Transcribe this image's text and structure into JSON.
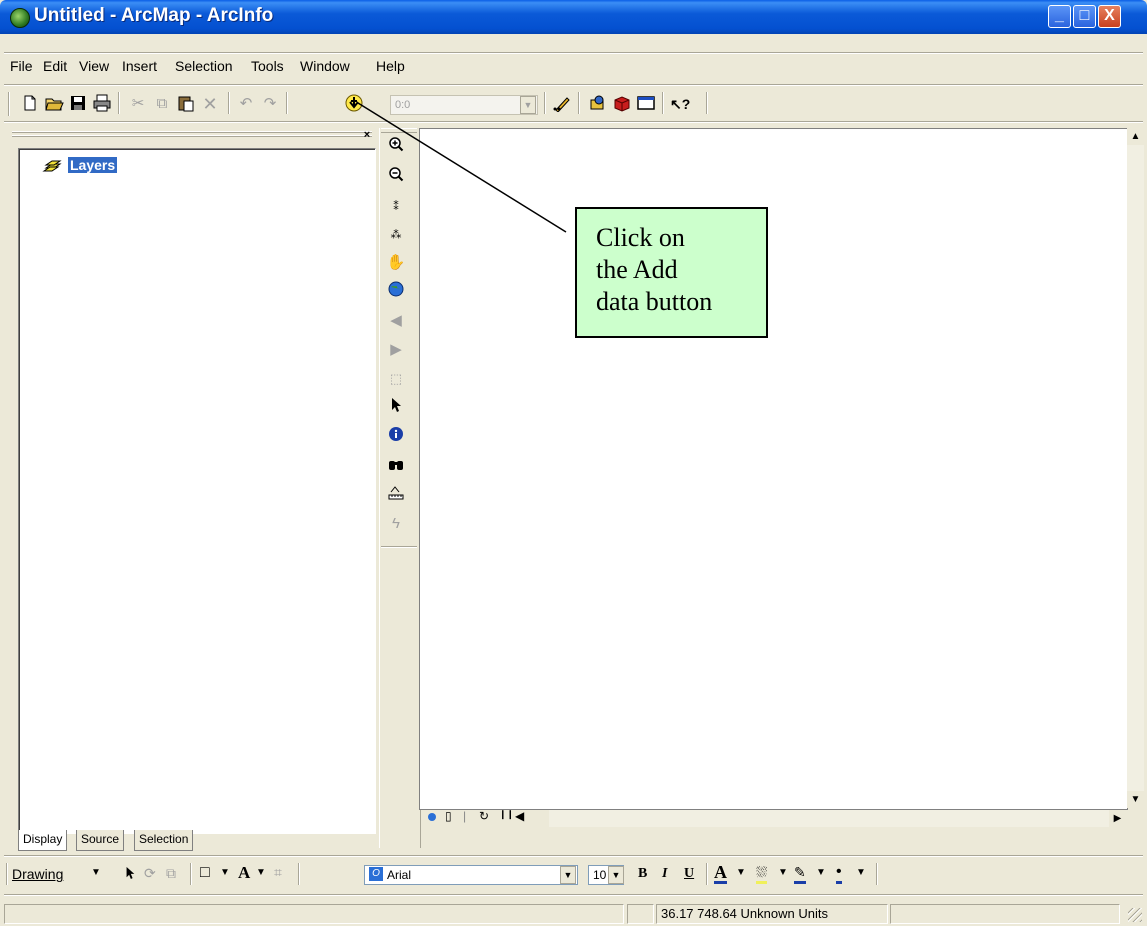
{
  "window": {
    "title": "Untitled - ArcMap - ArcInfo",
    "controls": {
      "minimize": "_",
      "maximize": "□",
      "close": "X"
    }
  },
  "menu": [
    "File",
    "Edit",
    "View",
    "Insert",
    "Selection",
    "Tools",
    "Window",
    "Help"
  ],
  "standard_toolbar": {
    "scale_value": "0:0",
    "buttons": [
      "new-icon",
      "open-icon",
      "save-icon",
      "print-icon",
      "cut-icon",
      "copy-icon",
      "paste-icon",
      "delete-icon",
      "undo-icon",
      "redo-icon",
      "add-data-icon",
      "editor-toolbar-icon",
      "arctoolbox-icon",
      "arccatalog-icon",
      "window-icon",
      "whats-this-icon"
    ]
  },
  "toc": {
    "root_label": "Layers",
    "tabs": [
      "Display",
      "Source",
      "Selection"
    ],
    "selected_color": "#316ac5"
  },
  "tools_toolbar": {
    "tools": [
      "zoom-in-icon",
      "zoom-out-icon",
      "fixed-zoom-in-icon",
      "fixed-zoom-out-icon",
      "pan-icon",
      "full-extent-icon",
      "back-icon",
      "forward-icon",
      "select-features-icon",
      "select-elements-icon",
      "identify-icon",
      "find-icon",
      "measure-icon",
      "hyperlink-icon"
    ]
  },
  "callout": {
    "lines": [
      "Click on",
      "the Add",
      "data button"
    ],
    "background": "#ccffcc"
  },
  "drawing_toolbar": {
    "drawing_label": "Drawing",
    "font_name": "Arial",
    "font_size": "10",
    "bold": "B",
    "italic": "I",
    "underline": "U",
    "font_color_glyph": "A"
  },
  "status_bar": {
    "coordinates": "36.17  748.64 Unknown Units"
  }
}
